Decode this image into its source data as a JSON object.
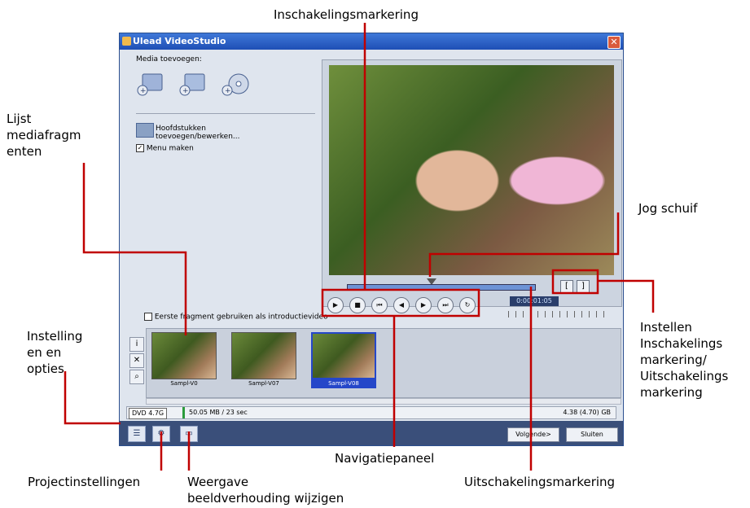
{
  "app": {
    "title": "Ulead VideoStudio",
    "close_label": "✕"
  },
  "left_panel": {
    "media_label": "Media toevoegen:",
    "media_icons": [
      "add-video-icon",
      "add-vcd-icon",
      "add-disc-icon"
    ],
    "chapters_label": "Hoofdstukken toevoegen/bewerken...",
    "menu_checkbox": {
      "label": "Menu maken",
      "checked": true
    },
    "first_clip_checkbox": {
      "label": "Eerste fragment gebruiken als introductievideo",
      "checked": false
    }
  },
  "preview": {
    "timecode": "0:00:01:05",
    "nav_buttons": [
      {
        "name": "play",
        "glyph": "▶"
      },
      {
        "name": "stop",
        "glyph": "■"
      },
      {
        "name": "home",
        "glyph": "⏮"
      },
      {
        "name": "prev-frame",
        "glyph": "◀"
      },
      {
        "name": "next-frame",
        "glyph": "▶"
      },
      {
        "name": "end",
        "glyph": "⏭"
      },
      {
        "name": "repeat",
        "glyph": "↻"
      }
    ],
    "mark_in_label": "[",
    "mark_out_label": "]"
  },
  "clips": [
    {
      "name": "Sampl-V0",
      "selected": false
    },
    {
      "name": "Sampl-V07",
      "selected": false
    },
    {
      "name": "Sampl-V08",
      "selected": true
    }
  ],
  "status": {
    "disc": "DVD 4.7G",
    "usage": "50.05 MB / 23 sec",
    "capacity": "4.38 (4.70) GB"
  },
  "footer": {
    "next_label": "Volgende>",
    "close_label": "Sluiten"
  },
  "annotations": {
    "mark_in": "Inschakelingsmarkering",
    "media_list": "Lijst\nmediafragm\nenten",
    "jog": "Jog schuif",
    "settings": "Instelling\nen en\nopties",
    "set_markers": "Instellen\nInschakelings\nmarkering/\nUitschakelings\nmarkering",
    "navigation": "Navigatiepaneel",
    "project_settings": "Projectinstellingen",
    "aspect_ratio": "Weergave\nbeeldverhouding wijzigen",
    "mark_out": "Uitschakelingsmarkering"
  },
  "colors": {
    "callout_line": "#c00000",
    "title_bar": "#1e4fb5",
    "selection": "#2547c9"
  }
}
